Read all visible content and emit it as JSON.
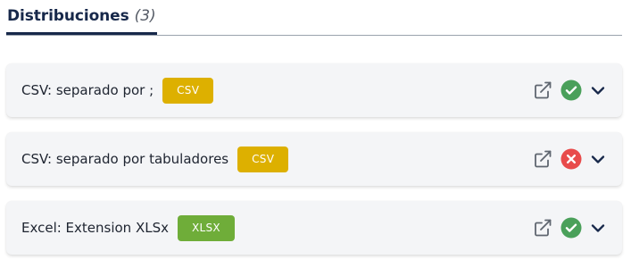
{
  "header": {
    "title": "Distribuciones",
    "count": "(3)"
  },
  "distributions": [
    {
      "title": "CSV: separado por ;",
      "format": "CSV",
      "status": "ok",
      "status_icon": "check-circle-icon",
      "status_color": "#4aa05a"
    },
    {
      "title": "CSV: separado por tabuladores",
      "format": "CSV",
      "status": "error",
      "status_icon": "x-circle-icon",
      "status_color": "#e84b4b"
    },
    {
      "title": "Excel: Extension XLSx",
      "format": "XLSX",
      "status": "ok",
      "status_icon": "check-circle-icon",
      "status_color": "#4aa05a"
    }
  ],
  "colors": {
    "navy": "#17284a",
    "badge_csv": "#ddb000",
    "badge_xlsx": "#6fad39",
    "card_bg": "#f4f5f7"
  },
  "icons": {
    "external_link": "external-link-icon",
    "expand": "chevron-down-icon"
  }
}
